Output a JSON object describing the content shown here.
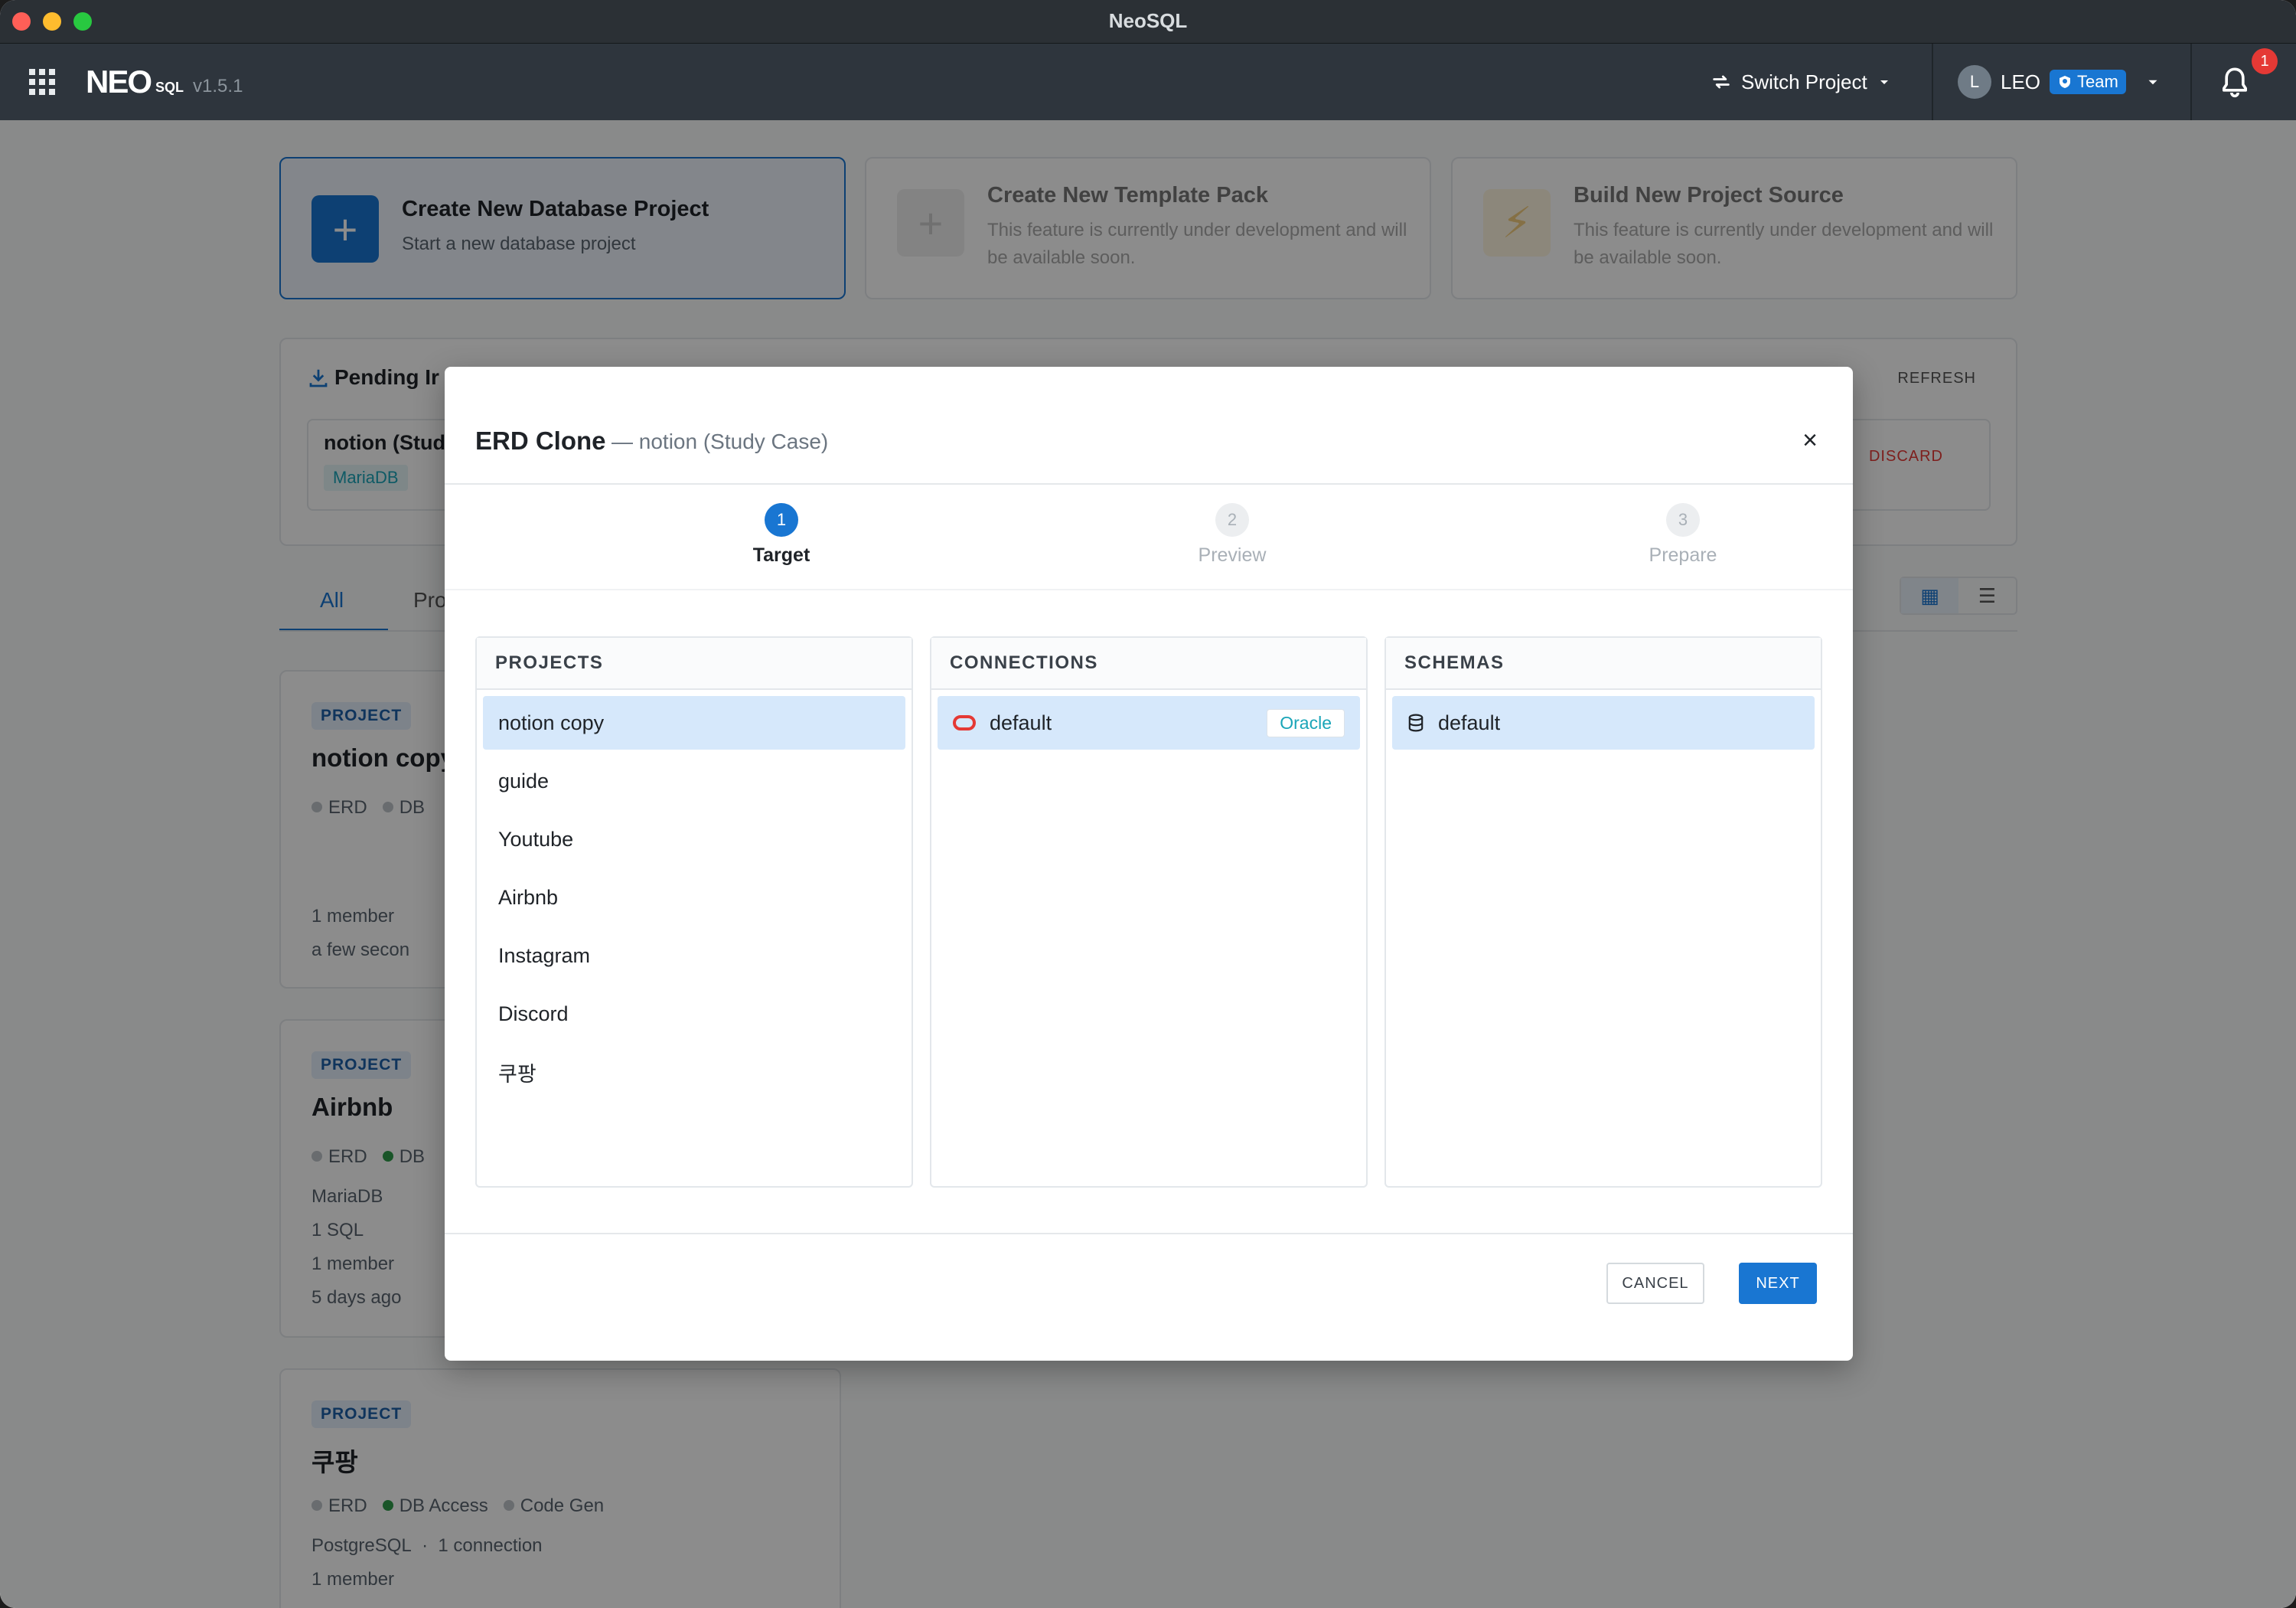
{
  "window": {
    "title": "NeoSQL"
  },
  "header": {
    "logo": "NEO",
    "logo_suffix": "SQL",
    "version": "v1.5.1",
    "switch_project": "Switch Project",
    "user_initial": "L",
    "user_name": "LEO",
    "team_badge": "Team",
    "notification_count": "1"
  },
  "actions": [
    {
      "title": "Create New Database Project",
      "desc": "Start a new database project"
    },
    {
      "title": "Create New Template Pack",
      "desc": "This feature is currently under development and will be available soon."
    },
    {
      "title": "Build New Project Source",
      "desc": "This feature is currently under development and will be available soon."
    }
  ],
  "pending": {
    "title": "Pending Ir",
    "refresh": "REFRESH",
    "item_name": "notion (Study",
    "item_db": "MariaDB",
    "discard": "DISCARD"
  },
  "tabs": {
    "all": "All",
    "pro": "Pro"
  },
  "projects_bg": [
    {
      "badge": "PROJECT",
      "name": "notion copy",
      "features": [
        "ERD",
        "DB"
      ],
      "members": "1 member",
      "time": "a few secon"
    },
    {
      "badge": "PROJECT",
      "name": "Airbnb",
      "features": [
        "ERD",
        "DB"
      ],
      "db": "MariaDB",
      "sql": "1 SQL",
      "members": "1 member",
      "time": "5 days ago"
    },
    {
      "badge": "PROJECT",
      "name": "쿠팡",
      "features": [
        "ERD",
        "DB Access",
        "Code Gen"
      ],
      "db": "PostgreSQL",
      "connections": "1 connection",
      "members": "1 member"
    }
  ],
  "modal": {
    "title": "ERD Clone",
    "subtitle": "— notion (Study Case)",
    "steps": [
      {
        "num": "1",
        "label": "Target"
      },
      {
        "num": "2",
        "label": "Preview"
      },
      {
        "num": "3",
        "label": "Prepare"
      }
    ],
    "projects_header": "PROJECTS",
    "projects": [
      "notion copy",
      "guide",
      "Youtube",
      "Airbnb",
      "Instagram",
      "Discord",
      "쿠팡"
    ],
    "connections_header": "CONNECTIONS",
    "connection": {
      "name": "default",
      "type": "Oracle"
    },
    "schemas_header": "SCHEMAS",
    "schema": "default",
    "cancel": "CANCEL",
    "next": "NEXT"
  },
  "colors": {
    "accent": "#1976d2",
    "header_bg": "#2e353d",
    "selected_row": "#d6e8fb",
    "oracle": "#e53935"
  }
}
